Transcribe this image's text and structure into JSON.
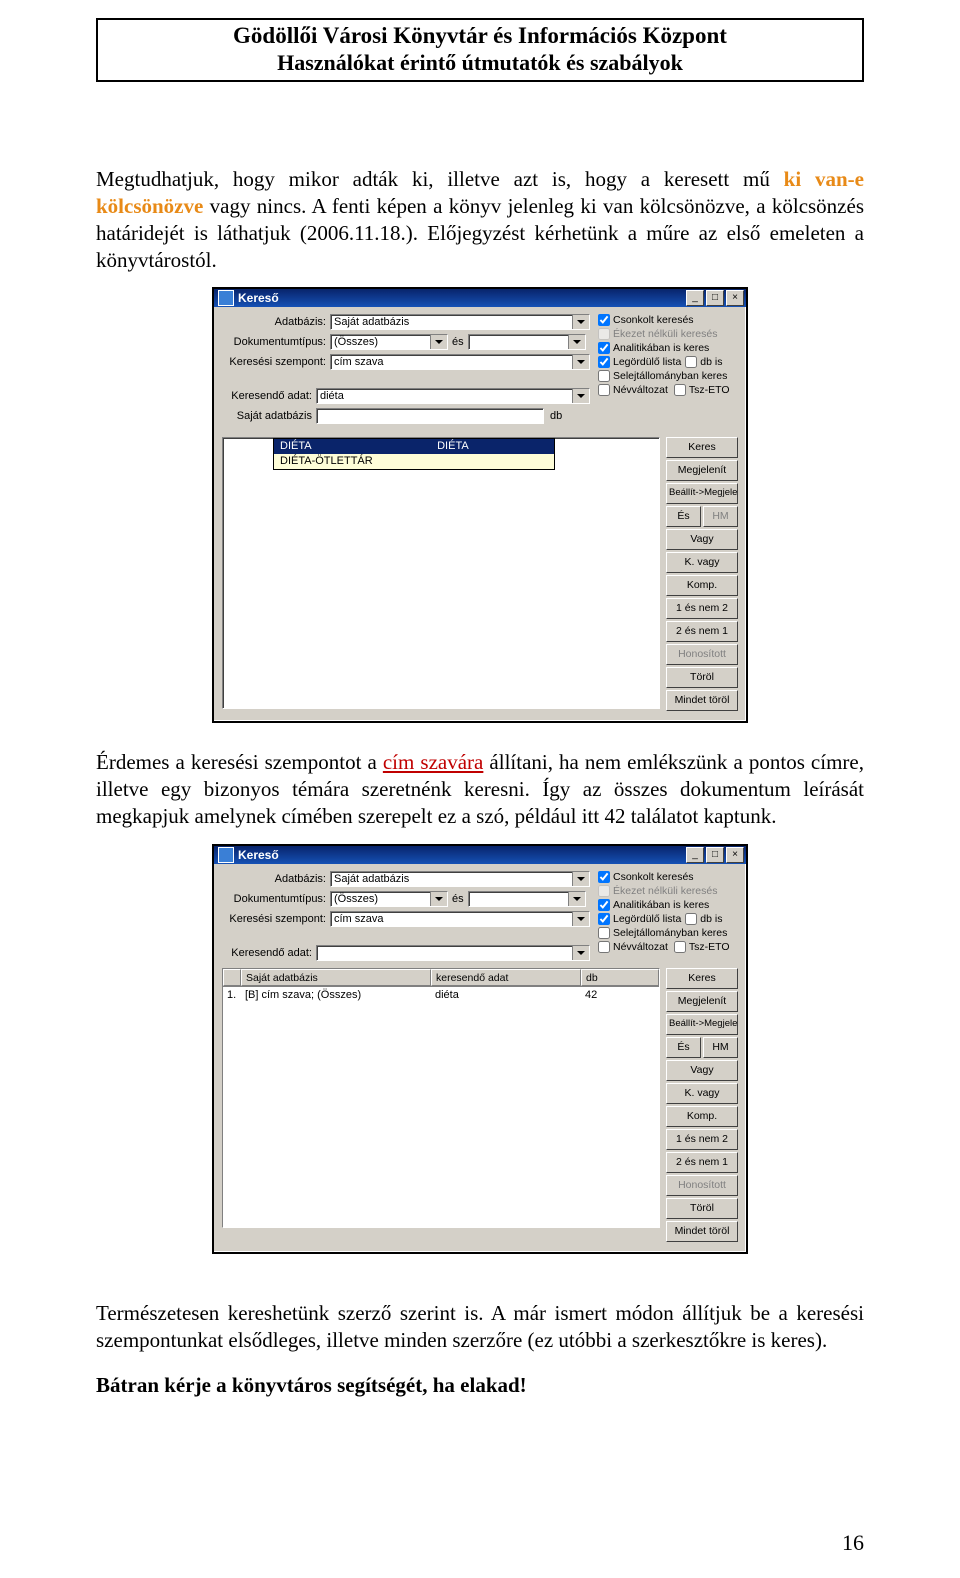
{
  "header": {
    "line1": "Gödöllői Városi Könyvtár és Információs Központ",
    "line2": "Használókat érintő útmutatók és szabályok"
  },
  "para1": {
    "a": "Megtudhatjuk, hogy mikor adták ki, illetve azt is, hogy a keresett mű ",
    "orange": "ki van-e kölcsönözve",
    "b": " vagy nincs. A fenti képen a könyv jelenleg ki van kölcsönözve, a kölcsönzés határidejét is láthatjuk (2006.11.18.). Előjegyzést kérhetünk a műre az első emeleten a könyvtárostól."
  },
  "para2": {
    "a": "Érdemes a keresési szempontot a ",
    "red": "cím szavára",
    "b": " állítani, ha nem emlékszünk a pontos címre, illetve egy bizonyos témára szeretnénk keresni. Így az összes dokumentum leírását megkapjuk amelynek címében szerepelt ez a szó, például itt 42 találatot kaptunk."
  },
  "para3": "Természetesen kereshetünk szerző szerint is. A már ismert módon állítjuk be a keresési szempontunkat elsődleges, illetve minden szerzőre (ez utóbbi a szerkesztőkre is keres).",
  "para4": "Bátran kérje a könyvtáros segítségét, ha elakad!",
  "page_number": "16",
  "window_common": {
    "title": "Kereső",
    "buttons_min": "_",
    "buttons_max": "□",
    "buttons_close": "×",
    "labels": {
      "adatbazis": "Adatbázis:",
      "dokumentumtipus": "Dokumentumtípus:",
      "keresesi_szempont": "Keresési szempont:",
      "keresendo_adat": "Keresendő adat:",
      "sajat_adatbazis_col": "Saját adatbázis",
      "es": "és",
      "db": "db"
    },
    "checks": {
      "csonkolt": "Csonkolt keresés",
      "ekezet": "Ékezet nélküli keresés",
      "analitikaban": "Analitikában is keres",
      "legordulo": "Legördülő lista",
      "dbis": "db is",
      "selejt": "Selejtállományban keres",
      "nevvaltozat": "Névváltozat",
      "tsz": "Tsz-ETO"
    },
    "action_buttons": {
      "keres": "Keres",
      "megjelenit": "Megjelenít",
      "beallit": "Beállít->Megjelenít",
      "es": "És",
      "vagy": "Vagy",
      "kvagy": "K. vagy",
      "komp": "Komp.",
      "esnem2": "1 és nem 2",
      "esnem1": "2 és nem 1",
      "honositott": "Honosított",
      "torol": "Töröl",
      "mindet": "Mindet töröl",
      "hm": "HM"
    }
  },
  "win1": {
    "adatbazis_value": "Saját adatbázis",
    "doktipus_value": "(Összes)",
    "szempont_value": "cím szava",
    "keresendo_value": "diéta",
    "dropdown": {
      "sel": "DIÉTA",
      "sel2": "DIÉTA",
      "opt": "DIÉTA-ÖTLETTÁR"
    }
  },
  "win2": {
    "adatbazis_value": "Saját adatbázis",
    "doktipus_value": "(Összes)",
    "szempont_value": "cím szava",
    "keresendo_value": "",
    "table": {
      "col1": "Saját adatbázis",
      "col2": "keresendő adat",
      "col3": "db",
      "row": {
        "idx": "1.",
        "c1": "[B] cím szava; (Összes)",
        "c2": "diéta",
        "c3": "42"
      }
    }
  }
}
